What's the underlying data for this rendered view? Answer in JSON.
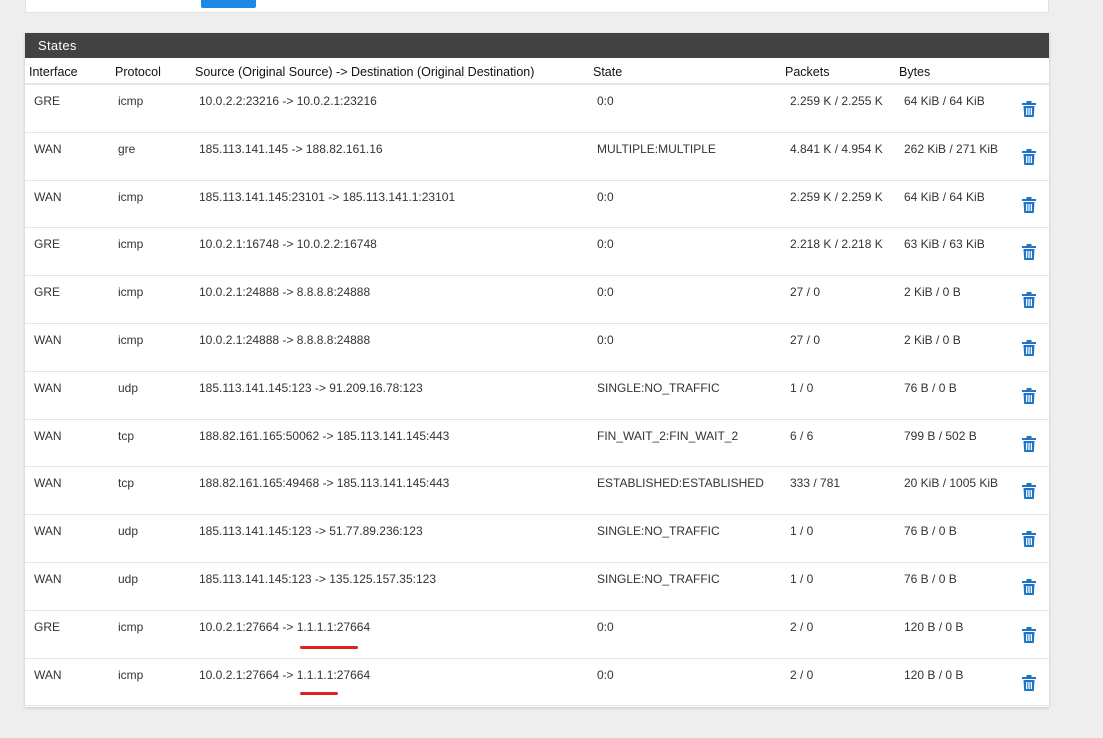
{
  "panel": {
    "title": "States"
  },
  "columns": {
    "interface": "Interface",
    "protocol": "Protocol",
    "source_dest": "Source (Original Source) -> Destination (Original Destination)",
    "state": "State",
    "packets": "Packets",
    "bytes": "Bytes"
  },
  "rows": [
    {
      "interface": "GRE",
      "protocol": "icmp",
      "source_dest": "10.0.2.2:23216 -> 10.0.2.1:23216",
      "state": "0:0",
      "packets": "2.259 K / 2.255 K",
      "bytes": "64 KiB / 64 KiB"
    },
    {
      "interface": "WAN",
      "protocol": "gre",
      "source_dest": "185.113.141.145 -> 188.82.161.16",
      "state": "MULTIPLE:MULTIPLE",
      "packets": "4.841 K / 4.954 K",
      "bytes": "262 KiB / 271 KiB"
    },
    {
      "interface": "WAN",
      "protocol": "icmp",
      "source_dest": "185.113.141.145:23101 -> 185.113.141.1:23101",
      "state": "0:0",
      "packets": "2.259 K / 2.259 K",
      "bytes": "64 KiB / 64 KiB"
    },
    {
      "interface": "GRE",
      "protocol": "icmp",
      "source_dest": "10.0.2.1:16748 -> 10.0.2.2:16748",
      "state": "0:0",
      "packets": "2.218 K / 2.218 K",
      "bytes": "63 KiB / 63 KiB"
    },
    {
      "interface": "GRE",
      "protocol": "icmp",
      "source_dest": "10.0.2.1:24888 -> 8.8.8.8:24888",
      "state": "0:0",
      "packets": "27 / 0",
      "bytes": "2 KiB / 0 B"
    },
    {
      "interface": "WAN",
      "protocol": "icmp",
      "source_dest": "10.0.2.1:24888 -> 8.8.8.8:24888",
      "state": "0:0",
      "packets": "27 / 0",
      "bytes": "2 KiB / 0 B"
    },
    {
      "interface": "WAN",
      "protocol": "udp",
      "source_dest": "185.113.141.145:123 -> 91.209.16.78:123",
      "state": "SINGLE:NO_TRAFFIC",
      "packets": "1 / 0",
      "bytes": "76 B / 0 B"
    },
    {
      "interface": "WAN",
      "protocol": "tcp",
      "source_dest": "188.82.161.165:50062 -> 185.113.141.145:443",
      "state": "FIN_WAIT_2:FIN_WAIT_2",
      "packets": "6 / 6",
      "bytes": "799 B / 502 B"
    },
    {
      "interface": "WAN",
      "protocol": "tcp",
      "source_dest": "188.82.161.165:49468 -> 185.113.141.145:443",
      "state": "ESTABLISHED:ESTABLISHED",
      "packets": "333 / 781",
      "bytes": "20 KiB / 1005 KiB"
    },
    {
      "interface": "WAN",
      "protocol": "udp",
      "source_dest": "185.113.141.145:123 -> 51.77.89.236:123",
      "state": "SINGLE:NO_TRAFFIC",
      "packets": "1 / 0",
      "bytes": "76 B / 0 B"
    },
    {
      "interface": "WAN",
      "protocol": "udp",
      "source_dest": "185.113.141.145:123 -> 135.125.157.35:123",
      "state": "SINGLE:NO_TRAFFIC",
      "packets": "1 / 0",
      "bytes": "76 B / 0 B"
    },
    {
      "interface": "GRE",
      "protocol": "icmp",
      "source_dest": "10.0.2.1:27664 -> 1.1.1.1:27664",
      "state": "0:0",
      "packets": "2 / 0",
      "bytes": "120 B / 0 B"
    },
    {
      "interface": "WAN",
      "protocol": "icmp",
      "source_dest": "10.0.2.1:27664 -> 1.1.1.1:27664",
      "state": "0:0",
      "packets": "2 / 0",
      "bytes": "120 B / 0 B"
    }
  ],
  "icons": {
    "row_action": "trash-icon"
  },
  "colors": {
    "heading_bg": "#424242",
    "trash_icon": "#1e74c6",
    "annotation": "#e0201c",
    "primary_button": "#1e88e5"
  }
}
